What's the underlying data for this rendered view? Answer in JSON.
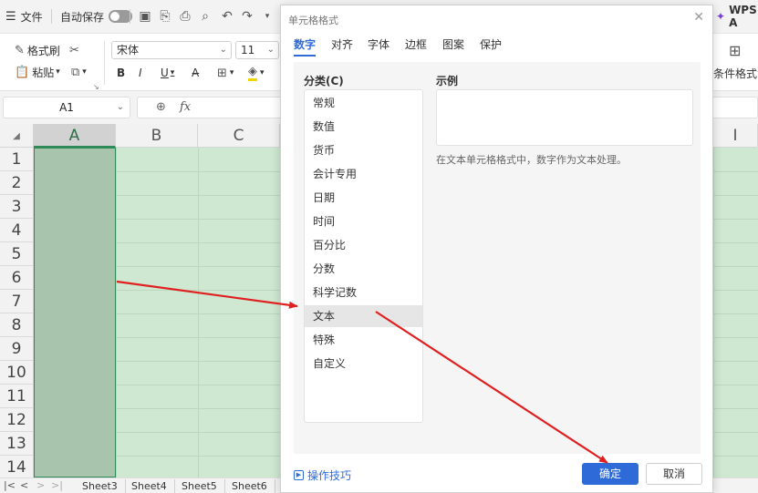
{
  "titlebar": {
    "menu_icon": "menu-icon",
    "file_label": "文件",
    "autosave_label": "自动保存",
    "brand": "WPS A"
  },
  "ribbon": {
    "format_painter": "格式刷",
    "paste": "粘贴",
    "font_name": "宋体",
    "font_size": "11",
    "bold": "B",
    "italic": "I",
    "underline": "U",
    "conditional_format": "条件格式"
  },
  "formula_bar": {
    "name_box": "A1",
    "fx": "fx"
  },
  "grid": {
    "columns": [
      "A",
      "B",
      "C",
      "I"
    ],
    "rows": [
      "1",
      "2",
      "3",
      "4",
      "5",
      "6",
      "7",
      "8",
      "9",
      "10",
      "11",
      "12",
      "13",
      "14"
    ],
    "selected_column": "A",
    "fill_color": "#cfe8d1",
    "selected_fill_color": "#a9c4ad"
  },
  "sheet_tabs": [
    "Sheet3",
    "Sheet4",
    "Sheet5",
    "Sheet6"
  ],
  "dialog": {
    "title": "单元格格式",
    "tabs": [
      "数字",
      "对齐",
      "字体",
      "边框",
      "图案",
      "保护"
    ],
    "active_tab": "数字",
    "category_label": "分类(C)",
    "categories": [
      "常规",
      "数值",
      "货币",
      "会计专用",
      "日期",
      "时间",
      "百分比",
      "分数",
      "科学记数",
      "文本",
      "特殊",
      "自定义"
    ],
    "selected_category": "文本",
    "sample_label": "示例",
    "description": "在文本单元格格式中，数字作为文本处理。",
    "tips_link": "操作技巧",
    "ok_button": "确定",
    "cancel_button": "取消",
    "accent_color": "#2f6bd8"
  },
  "annotation_color": "#e02020"
}
